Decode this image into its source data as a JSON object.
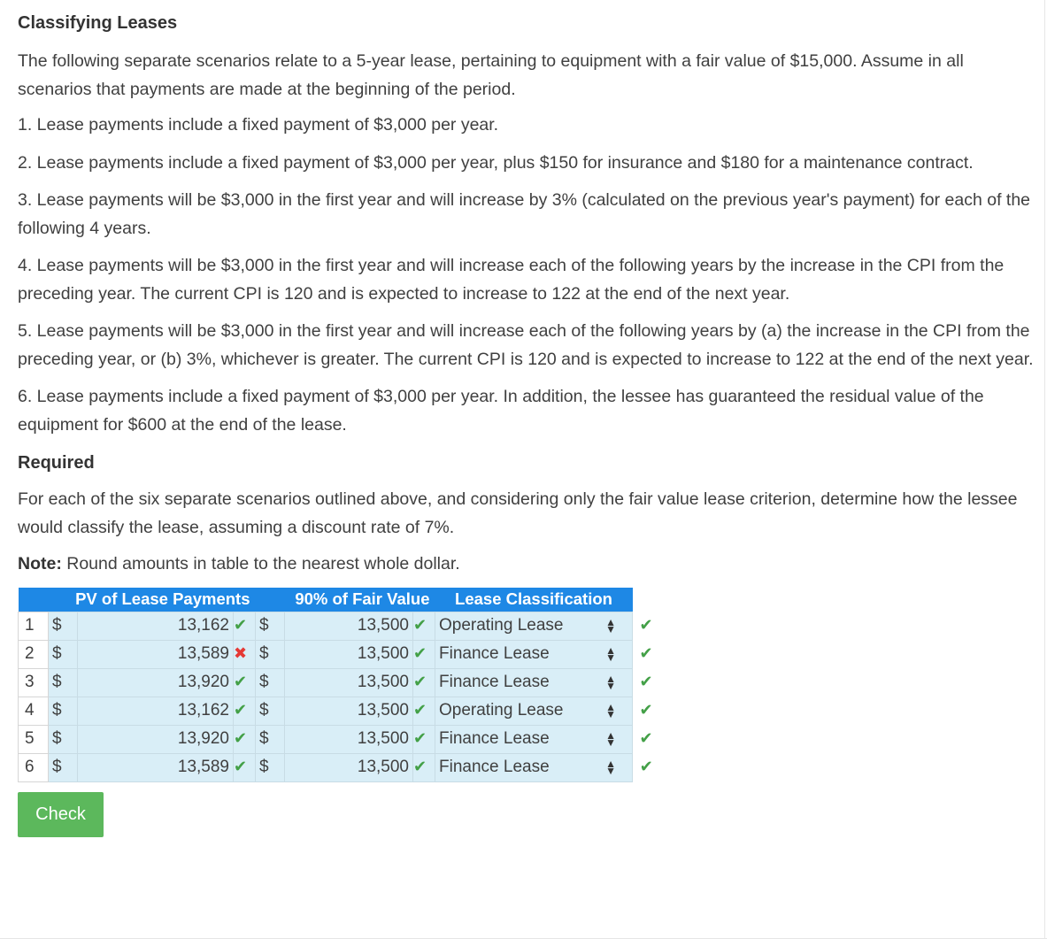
{
  "title": "Classifying Leases",
  "intro": "The following separate scenarios relate to a 5-year lease, pertaining to equipment with a fair value of $15,000. Assume in all scenarios that payments are made at the beginning of the period.",
  "scenarios": [
    "1. Lease payments include a fixed payment of $3,000 per year.",
    "2. Lease payments include a fixed payment of $3,000 per year, plus $150 for insurance and $180 for a maintenance contract.",
    "3. Lease payments will be $3,000 in the first year and will increase by 3% (calculated on the previous year's payment) for each of the following 4 years.",
    "4. Lease payments will be $3,000 in the first year and will increase each of the following years by the increase in the CPI from the preceding year. The current CPI is 120 and is expected to increase to 122 at the end of the next year.",
    "5. Lease payments will be $3,000 in the first year and will increase each of the following years by (a) the increase in the CPI from the preceding year, or (b) 3%, whichever is greater. The current CPI is 120 and is expected to increase to 122 at the end of the next year.",
    "6. Lease payments include a fixed payment of $3,000 per year. In addition, the lessee has guaranteed the residual value of the equipment for $600 at the end of the lease."
  ],
  "required_title": "Required",
  "required_text": "For each of the six separate scenarios outlined above, and considering only the fair value lease criterion, determine how the lessee would classify the lease, assuming a discount rate of 7%.",
  "note_label": "Note:",
  "note_text": " Round amounts in table to the nearest whole dollar.",
  "table": {
    "headers": [
      "PV of Lease Payments",
      "90% of Fair Value",
      "Lease Classification"
    ],
    "currency": "$",
    "rows": [
      {
        "num": "1",
        "pv": "13,162",
        "pv_status": "correct",
        "fv": "13,500",
        "fv_status": "correct",
        "classification": "Operating Lease",
        "cls_status": "correct"
      },
      {
        "num": "2",
        "pv": "13,589",
        "pv_status": "incorrect",
        "fv": "13,500",
        "fv_status": "correct",
        "classification": "Finance Lease",
        "cls_status": "correct"
      },
      {
        "num": "3",
        "pv": "13,920",
        "pv_status": "correct",
        "fv": "13,500",
        "fv_status": "correct",
        "classification": "Finance Lease",
        "cls_status": "correct"
      },
      {
        "num": "4",
        "pv": "13,162",
        "pv_status": "correct",
        "fv": "13,500",
        "fv_status": "correct",
        "classification": "Operating Lease",
        "cls_status": "correct"
      },
      {
        "num": "5",
        "pv": "13,920",
        "pv_status": "correct",
        "fv": "13,500",
        "fv_status": "correct",
        "classification": "Finance Lease",
        "cls_status": "correct"
      },
      {
        "num": "6",
        "pv": "13,589",
        "pv_status": "correct",
        "fv": "13,500",
        "fv_status": "correct",
        "classification": "Finance Lease",
        "cls_status": "correct"
      }
    ]
  },
  "check_button": "Check",
  "colors": {
    "header_bg": "#1e88e5",
    "cell_bg": "#d9eef7",
    "correct": "#43a047",
    "incorrect": "#e53935",
    "button": "#5cb85c"
  }
}
